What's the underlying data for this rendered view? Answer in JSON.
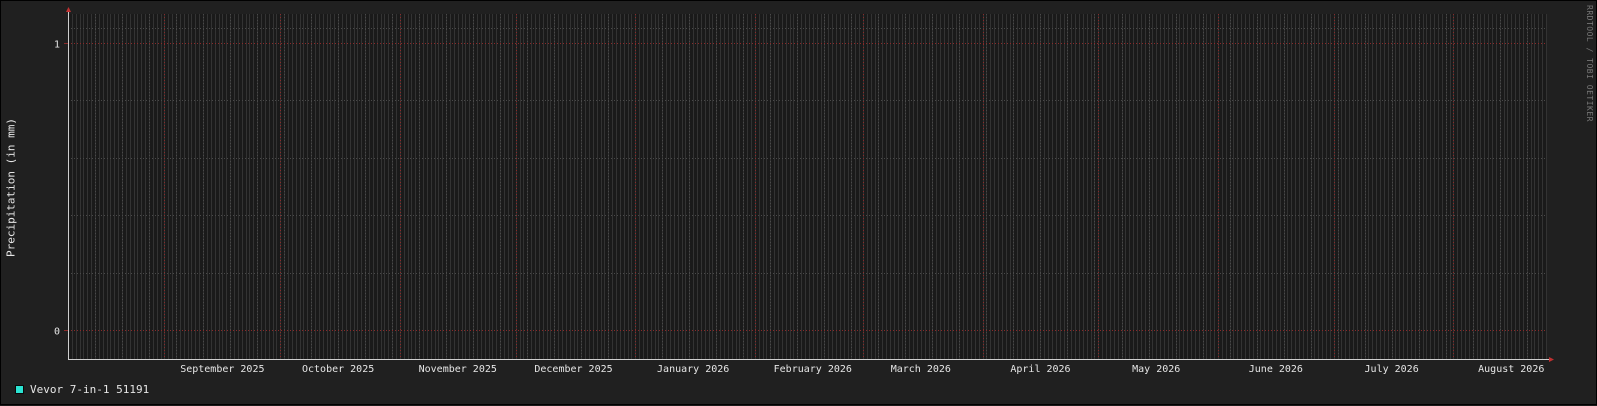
{
  "chart_data": {
    "type": "line",
    "title": "",
    "ylabel": "Precipitation (in mm)",
    "xlabel": "",
    "ylim": [
      -0.1,
      1.1
    ],
    "y_major_ticks": [
      0,
      1
    ],
    "x_range": [
      "2025-08-07",
      "2026-08-25"
    ],
    "x_tick_labels": [
      {
        "date": "2025-09-16",
        "label": "September 2025"
      },
      {
        "date": "2025-10-16",
        "label": "October 2025"
      },
      {
        "date": "2025-11-16",
        "label": "November 2025"
      },
      {
        "date": "2025-12-16",
        "label": "December 2025"
      },
      {
        "date": "2026-01-16",
        "label": "January 2026"
      },
      {
        "date": "2026-02-16",
        "label": "February 2026"
      },
      {
        "date": "2026-03-16",
        "label": "March 2026"
      },
      {
        "date": "2026-04-16",
        "label": "April 2026"
      },
      {
        "date": "2026-05-16",
        "label": "May 2026"
      },
      {
        "date": "2026-06-16",
        "label": "June 2026"
      },
      {
        "date": "2026-07-16",
        "label": "July 2026"
      },
      {
        "date": "2026-08-16",
        "label": "August 2026"
      }
    ],
    "series": [
      {
        "name": "Vevor 7-in-1 51191",
        "color": "#2be3d2",
        "values": []
      }
    ],
    "grid": true,
    "legend_placement": "bottom-left"
  },
  "watermark": "RRDTOOL / TOBI OETIKER",
  "colors": {
    "background": "#1a1a1a",
    "frame": "#202020",
    "major_grid": "#8a2a2a",
    "minor_grid": "#3a3a3a",
    "text": "#e6e6e6"
  }
}
